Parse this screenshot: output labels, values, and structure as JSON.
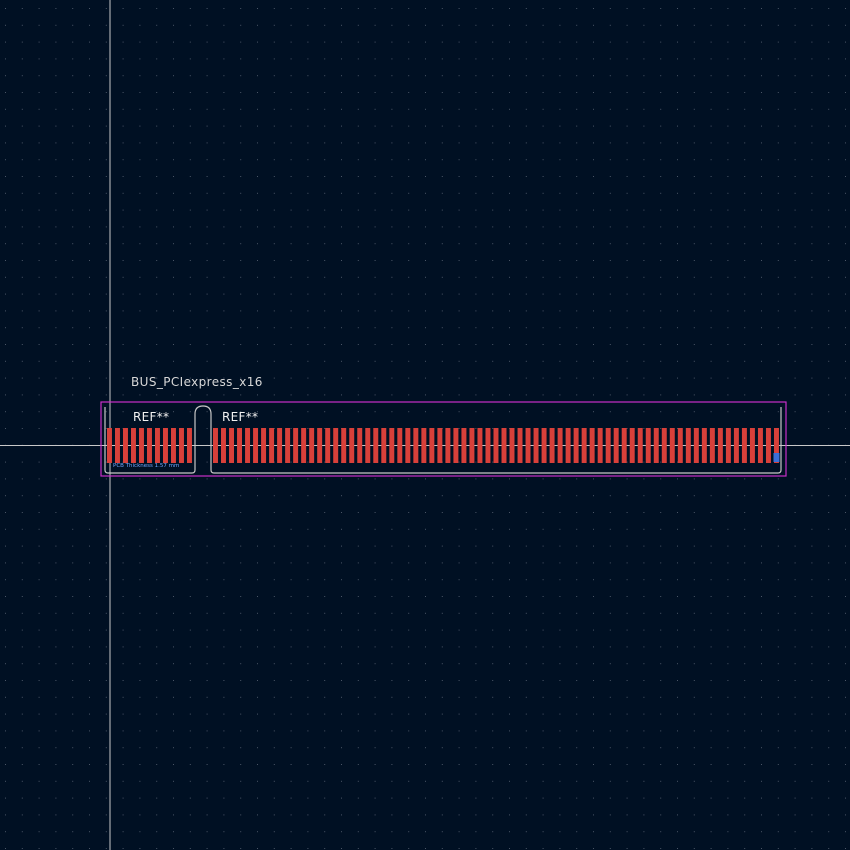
{
  "editor": {
    "footprint_value": "BUS_PCIexpress_x16",
    "ref_left": "REF**",
    "ref_right": "REF**",
    "pcb_note": "PCB Thickness 1.57 mm"
  },
  "pads": {
    "left_group_count": 11,
    "right_group_count": 71,
    "pin1_marker": "square"
  },
  "colors": {
    "background": "#001023",
    "grid_dot": "#4a5566",
    "crosshair": "#c8c8c8",
    "pad": "#d8403a",
    "pin1_pad": "#3a6fd8",
    "courtyard": "#c830c8",
    "outline": "#c8c8c8",
    "note_text": "#6fa8ff"
  }
}
